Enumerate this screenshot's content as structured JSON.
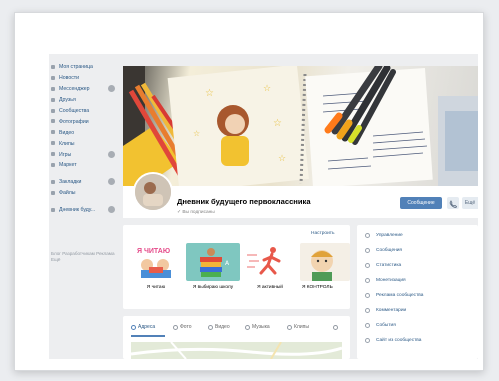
{
  "sidebar": {
    "items": [
      {
        "label": "Моя страница",
        "badge": false
      },
      {
        "label": "Новости",
        "badge": false
      },
      {
        "label": "Мессенджер",
        "badge": true
      },
      {
        "label": "Друзья",
        "badge": false
      },
      {
        "label": "Сообщества",
        "badge": false
      },
      {
        "label": "Фотографии",
        "badge": false
      },
      {
        "label": "Видео",
        "badge": false
      },
      {
        "label": "Клипы",
        "badge": false
      },
      {
        "label": "Игры",
        "badge": true
      },
      {
        "label": "Маркет",
        "badge": false
      }
    ],
    "items2": [
      {
        "label": "Закладки",
        "badge": true
      },
      {
        "label": "Файлы",
        "badge": false
      }
    ],
    "items3": [
      {
        "label": "Дневник буду...",
        "badge": true
      }
    ],
    "footer": "Блог Разработчикам Реклама Ещё"
  },
  "profile": {
    "title": "Дневник будущего первоклассника",
    "subscribed": "Вы подписаны",
    "message_button": "Сообщение",
    "more_button": "Ещё"
  },
  "mentions": {
    "configure": "Настроить",
    "items": [
      {
        "caption": "Я читаю",
        "art": "Я ЧИТАЮ"
      },
      {
        "caption": "Я выбираю школу",
        "art": ""
      },
      {
        "caption": "Я активный",
        "art": ""
      },
      {
        "caption": "Я КОНТРОЛЬ",
        "art": ""
      }
    ]
  },
  "tabs": [
    {
      "label": "Адреса",
      "active": true
    },
    {
      "label": "Фото",
      "active": false
    },
    {
      "label": "Видео",
      "active": false
    },
    {
      "label": "Музыка",
      "active": false
    },
    {
      "label": "Клипы",
      "active": false
    }
  ],
  "manage_menu": [
    {
      "label": "Управление"
    },
    {
      "label": "Сообщения"
    },
    {
      "label": "Статистика"
    },
    {
      "label": "Монетизация"
    },
    {
      "label": "Реклама сообщества"
    },
    {
      "label": "Комментарии"
    },
    {
      "label": "События"
    },
    {
      "label": "Сайт из сообщества"
    }
  ],
  "colors": {
    "accent": "#5181b8",
    "link": "#2a5885",
    "background": "#edeef0"
  }
}
